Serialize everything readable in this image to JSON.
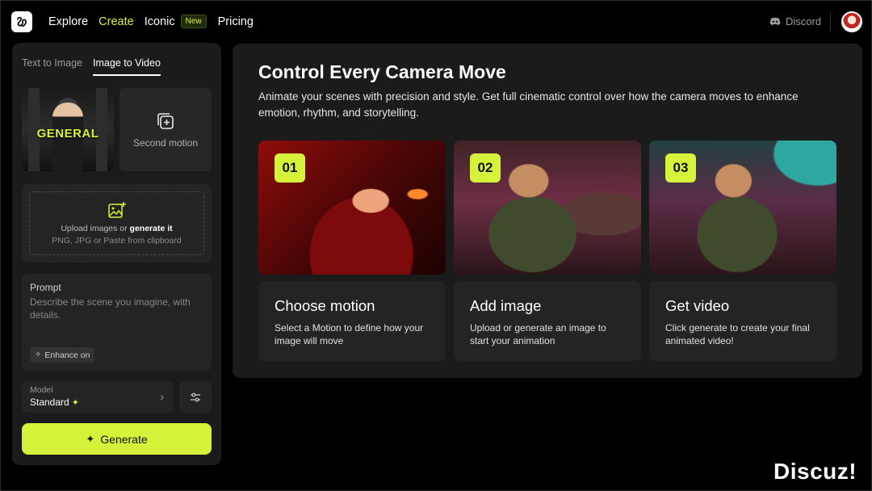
{
  "nav": {
    "items": [
      "Explore",
      "Create",
      "Iconic",
      "Pricing"
    ],
    "active": "Create",
    "new_badge": "New",
    "discord": "Discord"
  },
  "left": {
    "tabs": [
      "Text to Image",
      "Image to Video"
    ],
    "active_tab": "Image to Video",
    "thumb_text": "GENERAL",
    "second_motion": "Second motion",
    "upload": {
      "line1_prefix": "Upload images or ",
      "line1_bold": "generate it",
      "line2": "PNG, JPG or Paste from clipboard"
    },
    "prompt": {
      "label": "Prompt",
      "placeholder": "Describe the scene you imagine, with details.",
      "enhance": "Enhance on"
    },
    "model": {
      "label": "Model",
      "value": "Standard"
    },
    "generate": "Generate"
  },
  "main": {
    "title": "Control Every Camera Move",
    "description": "Animate your scenes with precision and style. Get full cinematic control over how the camera moves to enhance emotion, rhythm, and storytelling.",
    "steps": [
      {
        "num": "01",
        "title": "Choose motion",
        "desc": "Select a Motion to define how your image will move"
      },
      {
        "num": "02",
        "title": "Add image",
        "desc": "Upload or generate an image to start your animation"
      },
      {
        "num": "03",
        "title": "Get video",
        "desc": "Click generate to create your final animated video!"
      }
    ]
  },
  "watermark": "Discuz!",
  "colors": {
    "accent": "#d7f23a",
    "panel": "#1b1b1b",
    "field": "#242424",
    "background": "#000000"
  }
}
